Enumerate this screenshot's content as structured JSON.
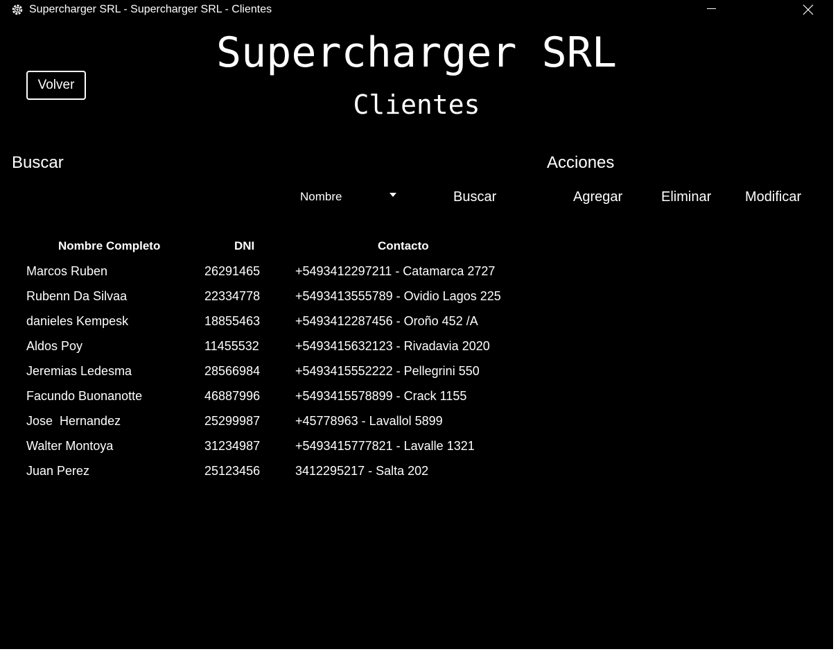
{
  "window": {
    "title": "Supercharger SRL - Supercharger SRL - Clientes",
    "icon": "gear-lightning-icon",
    "controls": [
      "minimize-icon",
      "close-icon"
    ],
    "background": "#000000",
    "foreground": "#ffffff"
  },
  "header": {
    "back_label": "Volver",
    "title": "Supercharger SRL",
    "subtitle": "Clientes"
  },
  "search": {
    "label": "Buscar",
    "filter_selected": "Nombre",
    "button_label": "Buscar"
  },
  "actions": {
    "label": "Acciones",
    "add_label": "Agregar",
    "delete_label": "Eliminar",
    "edit_label": "Modificar"
  },
  "table": {
    "columns": [
      "Nombre Completo",
      "DNI",
      "Contacto"
    ],
    "rows": [
      {
        "name": "Marcos Ruben",
        "dni": "26291465",
        "contact": "+5493412297211 - Catamarca 2727"
      },
      {
        "name": "Rubenn Da Silvaa",
        "dni": "22334778",
        "contact": "+5493413555789 - Ovidio Lagos 225"
      },
      {
        "name": "danieles Kempesk",
        "dni": "18855463",
        "contact": "+5493412287456 - Oroño 452 /A"
      },
      {
        "name": "Aldos Poy",
        "dni": "11455532",
        "contact": "+5493415632123 - Rivadavia 2020"
      },
      {
        "name": "Jeremias Ledesma",
        "dni": "28566984",
        "contact": "+5493415552222 - Pellegrini 550"
      },
      {
        "name": "Facundo Buonanotte",
        "dni": "46887996",
        "contact": "+5493415578899 - Crack 1155"
      },
      {
        "name": "Jose  Hernandez",
        "dni": "25299987",
        "contact": "+45778963 - Lavallol 5899"
      },
      {
        "name": "Walter Montoya",
        "dni": "31234987",
        "contact": "+5493415777821 - Lavalle 1321"
      },
      {
        "name": "Juan Perez",
        "dni": "25123456",
        "contact": "3412295217 - Salta 202"
      }
    ]
  }
}
